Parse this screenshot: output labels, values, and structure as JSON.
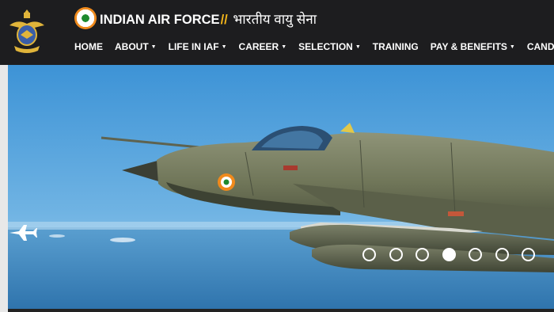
{
  "header": {
    "brand_en": "INDIAN AIR FORCE",
    "brand_sep": "//",
    "brand_hi": "भारतीय वायु सेना"
  },
  "nav": {
    "items": [
      {
        "label": "HOME",
        "dropdown": false
      },
      {
        "label": "ABOUT",
        "dropdown": true
      },
      {
        "label": "LIFE IN IAF",
        "dropdown": true
      },
      {
        "label": "CAREER",
        "dropdown": true
      },
      {
        "label": "SELECTION",
        "dropdown": true
      },
      {
        "label": "TRAINING",
        "dropdown": false
      },
      {
        "label": "PAY & BENEFITS",
        "dropdown": true
      },
      {
        "label": "CANDIDATE",
        "dropdown": false
      }
    ]
  },
  "carousel": {
    "slide_count": 7,
    "active_index": 3
  },
  "colors": {
    "header_bg": "#1d1d1f",
    "accent_saffron": "#f08a1c",
    "accent_green": "#1e8a2e",
    "separator": "#f3b51a",
    "sky": "#4f9fd8"
  },
  "icons": {
    "emblem": "iaf-crest-emblem",
    "roundel": "iaf-roundel-icon",
    "slide_arrow": "jet-arrow-icon"
  }
}
